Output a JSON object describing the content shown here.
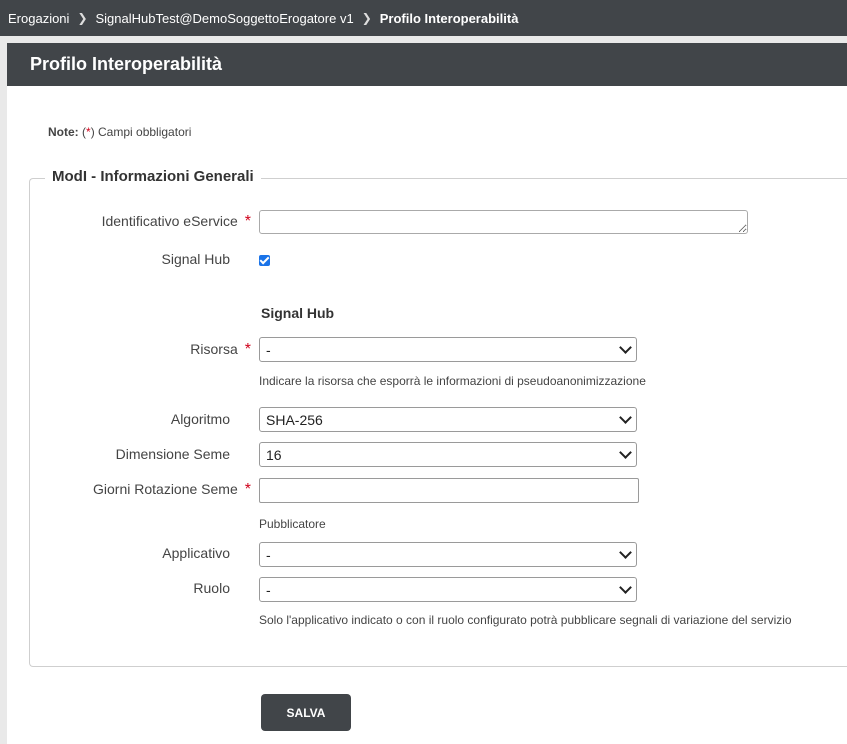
{
  "breadcrumb": {
    "items": [
      "Erogazioni",
      "SignalHubTest@DemoSoggettoErogatore v1"
    ],
    "current": "Profilo Interoperabilità"
  },
  "panel": {
    "title": "Profilo Interoperabilità"
  },
  "note": {
    "label": "Note:",
    "open": "(",
    "star": "*",
    "text": ") Campi obbligatori"
  },
  "section": {
    "legend": "ModI - Informazioni Generali"
  },
  "fields": {
    "eservice_label": "Identificativo eService",
    "signal_hub_label": "Signal Hub",
    "signal_hub_checked": true,
    "subsection_title": "Signal Hub",
    "risorsa_label": "Risorsa",
    "risorsa_value": "-",
    "risorsa_hint": "Indicare la risorsa che esporrà le informazioni di pseudoanonimizzazione",
    "algoritmo_label": "Algoritmo",
    "algoritmo_value": "SHA-256",
    "dimensione_label": "Dimensione Seme",
    "dimensione_value": "16",
    "giorni_label": "Giorni Rotazione Seme",
    "pubblicatore_title": "Pubblicatore",
    "applicativo_label": "Applicativo",
    "applicativo_value": "-",
    "ruolo_label": "Ruolo",
    "ruolo_value": "-",
    "ruolo_hint": "Solo l'applicativo indicato o con il ruolo configurato potrà pubblicare segnali di variazione del servizio",
    "required_mark": "*"
  },
  "actions": {
    "save_label": "SALVA"
  },
  "colors": {
    "header": "#414549",
    "required": "#d0021b",
    "checkbox": "#1a73e8"
  }
}
